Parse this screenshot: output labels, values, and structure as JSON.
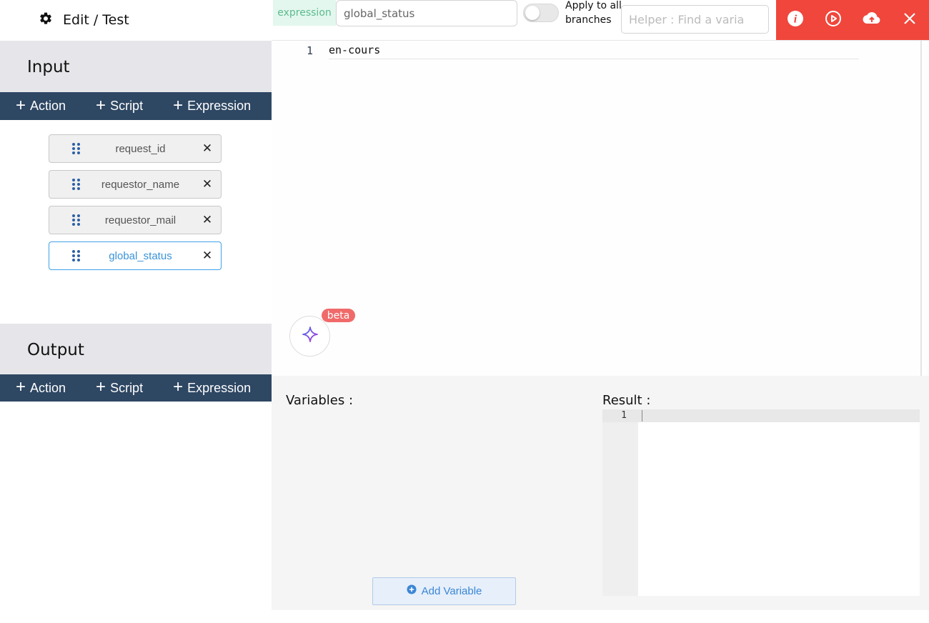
{
  "header": {
    "title": "Edit / Test",
    "expression_tag": "expression",
    "expression_value": "global_status",
    "apply_all_label": "Apply to all branches",
    "apply_all_enabled": false,
    "helper_placeholder": "Helper : Find a varia"
  },
  "action_bar": {
    "color": "#f0463c",
    "icons": [
      "info-icon",
      "play-icon",
      "cloud-upload-icon",
      "close-icon"
    ]
  },
  "input_section": {
    "title": "Input",
    "toolbar": {
      "action": "Action",
      "script": "Script",
      "expression": "Expression"
    },
    "variables": [
      {
        "label": "request_id",
        "active": false
      },
      {
        "label": "requestor_name",
        "active": false
      },
      {
        "label": "requestor_mail",
        "active": false
      },
      {
        "label": "global_status",
        "active": true
      }
    ]
  },
  "output_section": {
    "title": "Output",
    "toolbar": {
      "action": "Action",
      "script": "Script",
      "expression": "Expression"
    }
  },
  "editor": {
    "line_number": "1",
    "code": "en-cours"
  },
  "ai_assistant": {
    "badge": "beta"
  },
  "test_panel": {
    "variables_title": "Variables :",
    "add_variable_label": "Add Variable",
    "result_title": "Result :",
    "result_line_number": "1"
  }
}
